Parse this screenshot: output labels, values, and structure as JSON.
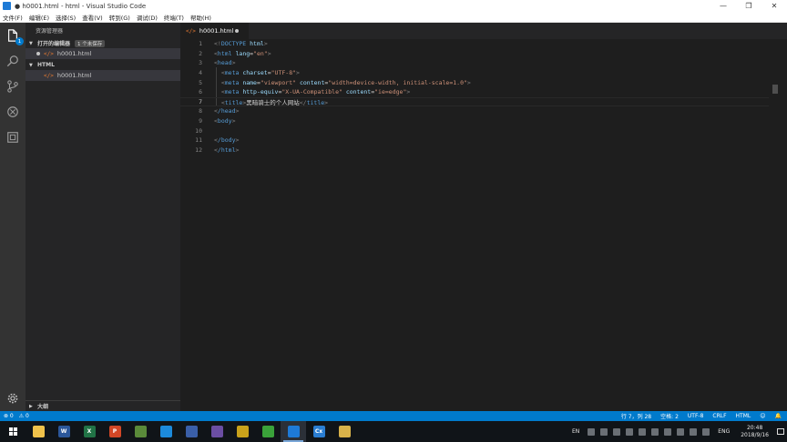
{
  "window": {
    "title": "● h0001.html - html - Visual Studio Code",
    "controls": [
      "—",
      "❐",
      "✕"
    ]
  },
  "menu": [
    "文件(F)",
    "编辑(E)",
    "选择(S)",
    "查看(V)",
    "转到(G)",
    "调试(D)",
    "终端(T)",
    "帮助(H)"
  ],
  "activity": {
    "badge": "1"
  },
  "sidebar": {
    "title": "资源管理器",
    "open_editors": {
      "label": "打开的编辑器",
      "count": "1 个未保存",
      "items": [
        {
          "name": "h0001.html"
        }
      ]
    },
    "folder": {
      "label": "HTML",
      "items": [
        {
          "name": "h0001.html"
        }
      ]
    },
    "outline": "大纲"
  },
  "tab": {
    "label": "h0001.html",
    "icon_text": "</>"
  },
  "editor": {
    "line_numbers": [
      "1",
      "2",
      "3",
      "4",
      "5",
      "6",
      "7",
      "8",
      "9",
      "10",
      "11",
      "12"
    ],
    "lines": {
      "l1_open": "<!",
      "l1_tag": "DOCTYPE",
      "l1_attr": " html",
      "l1_close": ">",
      "l2_open": "<",
      "l2_tag": "html",
      "l2_attr": " lang",
      "l2_eq": "=",
      "l2_str": "\"en\"",
      "l2_close": ">",
      "l3": "head",
      "l4_tag": "meta",
      "l4_attr": " charset",
      "l4_str": "\"UTF-8\"",
      "l5_tag": "meta",
      "l5_attr1": " name",
      "l5_str1": "\"viewport\"",
      "l5_attr2": " content",
      "l5_str2": "\"width=device-width, initial-scale=1.0\"",
      "l6_tag": "meta",
      "l6_attr1": " http-equiv",
      "l6_str1": "\"X-UA-Compatible\"",
      "l6_attr2": " content",
      "l6_str2": "\"ie=edge\"",
      "l7_tag": "title",
      "l7_text": "黑暗骑士的个人网站",
      "l8": "/head",
      "l9": "body",
      "l11": "/body",
      "l12": "/html"
    }
  },
  "status": {
    "errors": "⊗ 0",
    "warnings": "⚠ 0",
    "position": "行 7，列 28",
    "spaces": "空格: 2",
    "encoding": "UTF-8",
    "eol": "CRLF",
    "language": "HTML",
    "feedback": "☺",
    "bell": "🔔"
  },
  "taskbar": {
    "apps": [
      {
        "name": "File Explorer",
        "label": "",
        "color": "#f0c24b"
      },
      {
        "name": "Word",
        "label": "W",
        "color": "#2b579a"
      },
      {
        "name": "Excel",
        "label": "X",
        "color": "#217346"
      },
      {
        "name": "PowerPoint",
        "label": "P",
        "color": "#d24726"
      },
      {
        "name": "App",
        "label": "",
        "color": "#5a8a3a"
      },
      {
        "name": "App",
        "label": "",
        "color": "#1c8adb"
      },
      {
        "name": "App",
        "label": "",
        "color": "#3a5fa8"
      },
      {
        "name": "App",
        "label": "",
        "color": "#6b4ea3"
      },
      {
        "name": "App",
        "label": "",
        "color": "#c9a21b"
      },
      {
        "name": "App",
        "label": "",
        "color": "#3aa23a"
      },
      {
        "name": "VS Code",
        "label": "",
        "color": "#1e7ad6"
      },
      {
        "name": "App",
        "label": "Cx",
        "color": "#2a7dd1"
      },
      {
        "name": "App",
        "label": "",
        "color": "#d8b24a"
      }
    ],
    "tray": {
      "input_lang": "EN",
      "lang": "ENG",
      "time": "20:48",
      "date": "2018/9/16"
    }
  }
}
